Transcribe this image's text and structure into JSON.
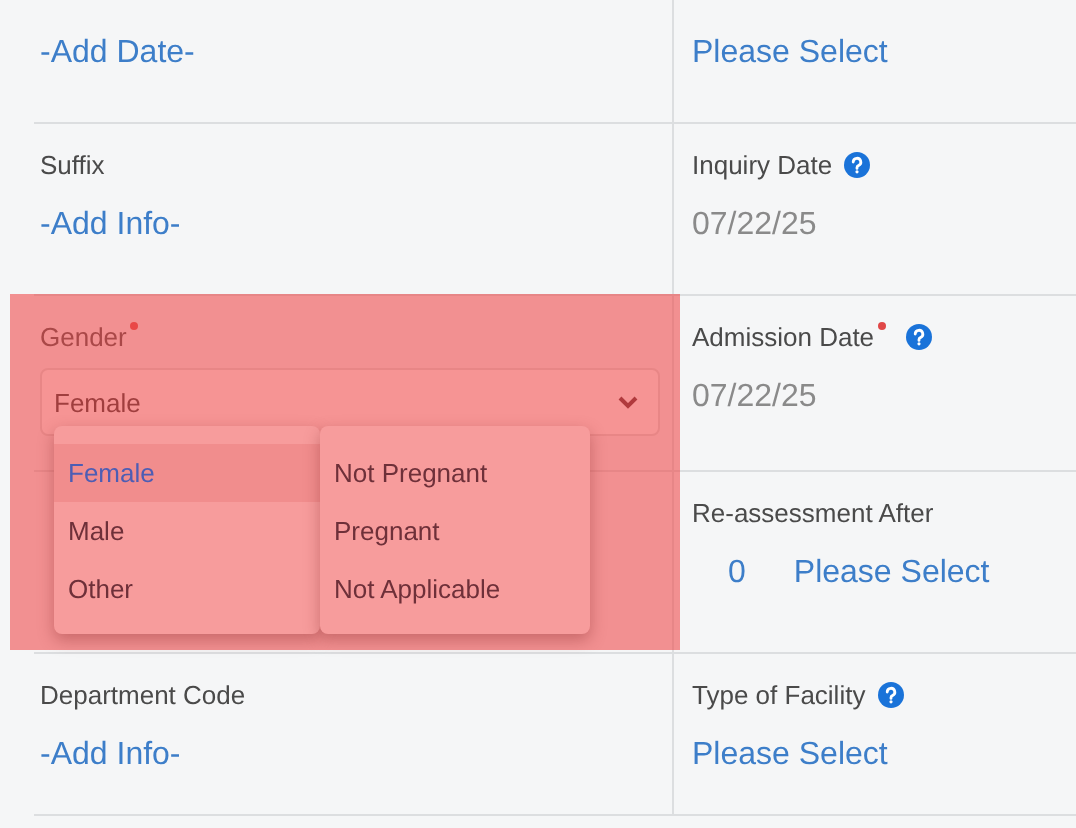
{
  "rows": [
    {
      "cells": [
        {
          "value": "-Add Date-",
          "kind": "link"
        },
        {
          "value": "Please Select",
          "kind": "link"
        }
      ]
    },
    {
      "cells": [
        {
          "label": "Suffix",
          "value": "-Add Info-",
          "kind": "link"
        },
        {
          "label": "Inquiry Date",
          "help": true,
          "value": "07/22/25",
          "kind": "date"
        }
      ]
    },
    {
      "cells": [
        {
          "label": "Gender",
          "required": true,
          "value": "Female",
          "kind": "select"
        },
        {
          "label": "Admission Date",
          "required": true,
          "help": true,
          "value": "07/22/25",
          "kind": "date"
        }
      ]
    },
    {
      "cells": [
        {
          "kind": "hidden"
        },
        {
          "label": "Re-assessment After",
          "count": "0",
          "value": "Please Select",
          "kind": "count_select"
        }
      ]
    },
    {
      "cells": [
        {
          "label": "Department Code",
          "value": "-Add Info-",
          "kind": "link"
        },
        {
          "label": "Type of Facility",
          "help": true,
          "value": "Please Select",
          "kind": "link"
        }
      ]
    }
  ],
  "highlight": true,
  "gender_menu": [
    {
      "label": "Female",
      "selected": true
    },
    {
      "label": "Male",
      "selected": false
    },
    {
      "label": "Other",
      "selected": false
    }
  ],
  "pregnancy_menu": [
    {
      "label": "Not Pregnant",
      "selected": false
    },
    {
      "label": "Pregnant",
      "selected": false
    },
    {
      "label": "Not Applicable",
      "selected": false
    }
  ]
}
